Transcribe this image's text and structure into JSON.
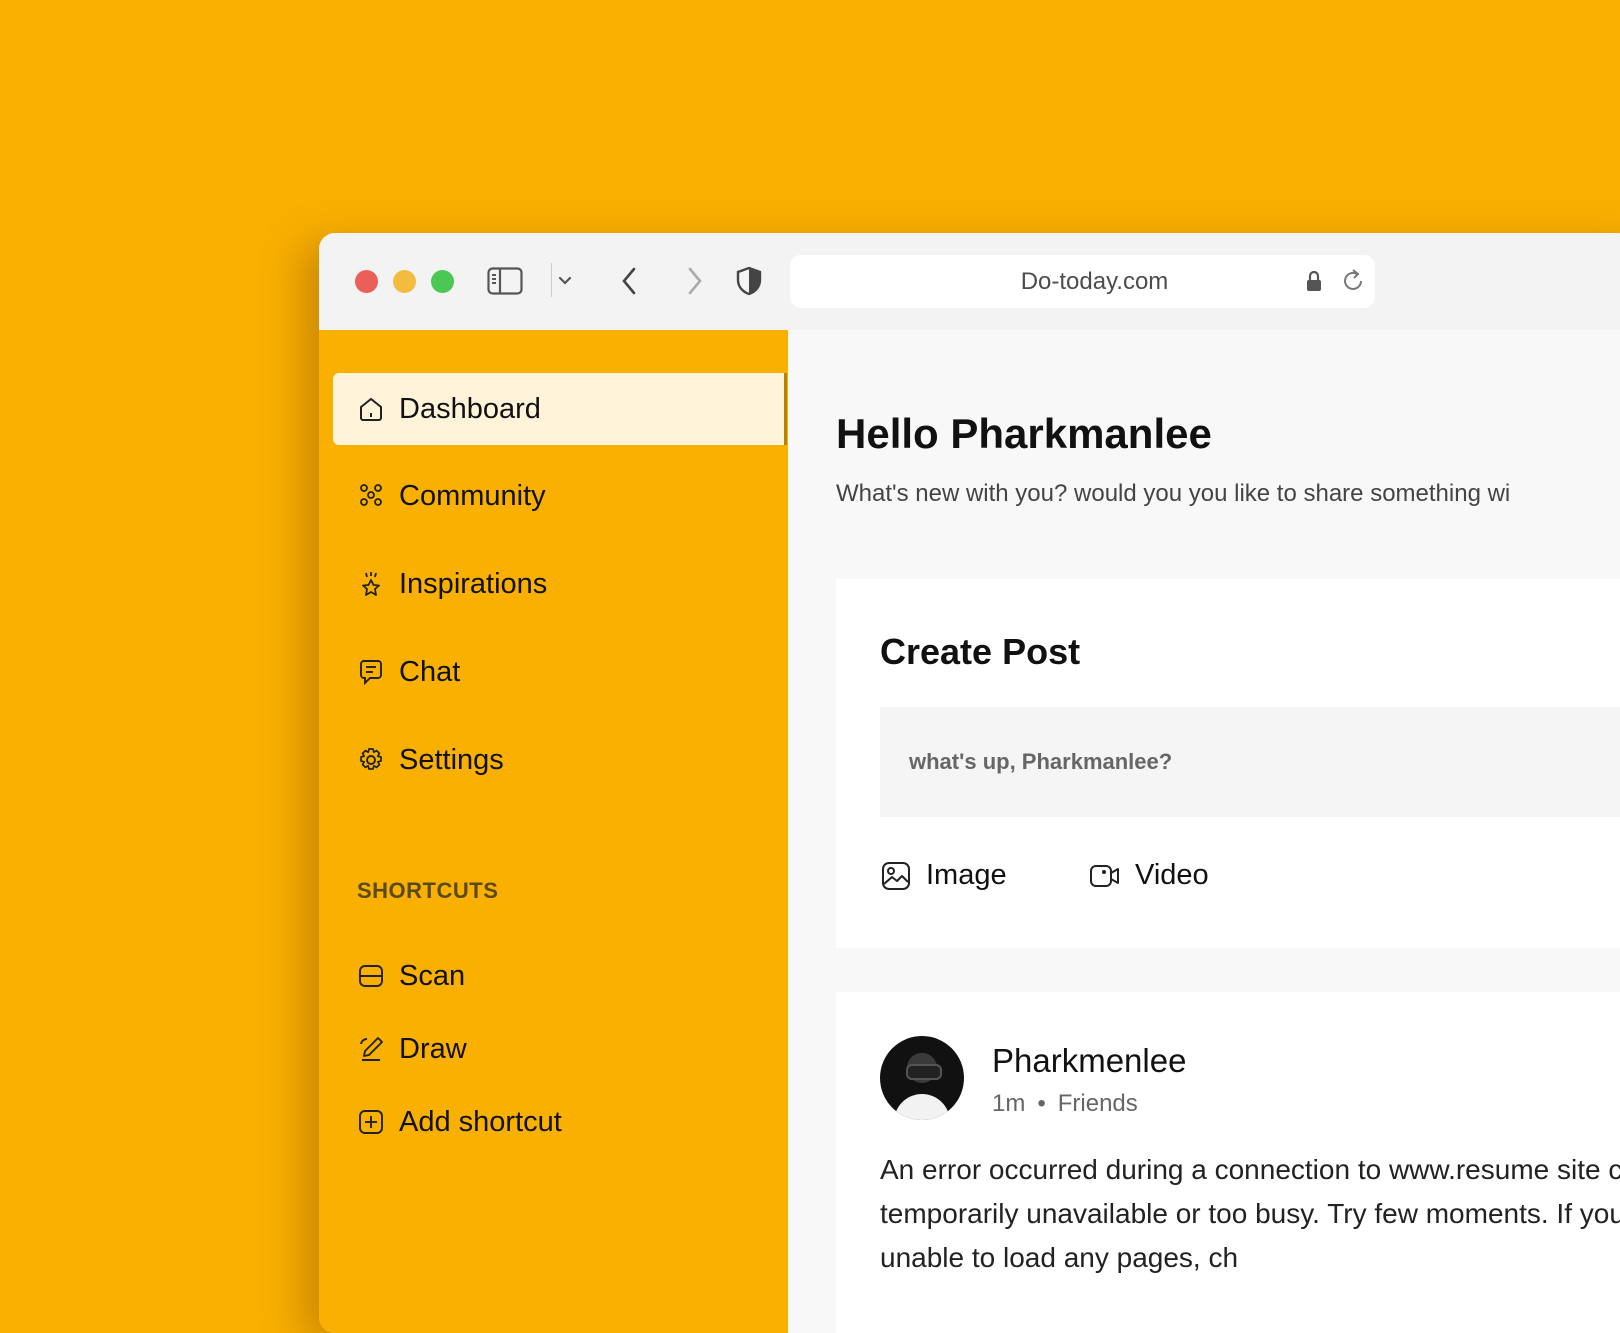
{
  "browser": {
    "url": "Do-today.com"
  },
  "sidebar": {
    "items": [
      {
        "label": "Dashboard",
        "icon": "home-icon",
        "active": true
      },
      {
        "label": "Community",
        "icon": "community-icon"
      },
      {
        "label": "Inspirations",
        "icon": "inspiration-icon"
      },
      {
        "label": "Chat",
        "icon": "chat-icon"
      },
      {
        "label": "Settings",
        "icon": "gear-icon"
      }
    ],
    "shortcuts_label": "SHORTCUTS",
    "shortcuts": [
      {
        "label": "Scan",
        "icon": "scan-icon"
      },
      {
        "label": "Draw",
        "icon": "draw-icon"
      },
      {
        "label": "Add shortcut",
        "icon": "add-icon"
      }
    ]
  },
  "main": {
    "greeting": "Hello Pharkmanlee",
    "subtitle": "What's new with you? would you you like to share something wi",
    "create_post": {
      "title": "Create Post",
      "placeholder": "what's up, Pharkmanlee?",
      "image_label": "Image",
      "video_label": "Video"
    },
    "post": {
      "author": "Pharkmenlee",
      "time": "1m",
      "separator": "•",
      "audience": "Friends",
      "body": "An error occurred during a connection to www.resume site could be temporarily unavailable or too busy. Try few moments. If you are unable to load any pages, ch"
    }
  },
  "colors": {
    "background": "#FAB000",
    "sidebar": "#FAB000",
    "active_item": "#FFF3D9"
  }
}
